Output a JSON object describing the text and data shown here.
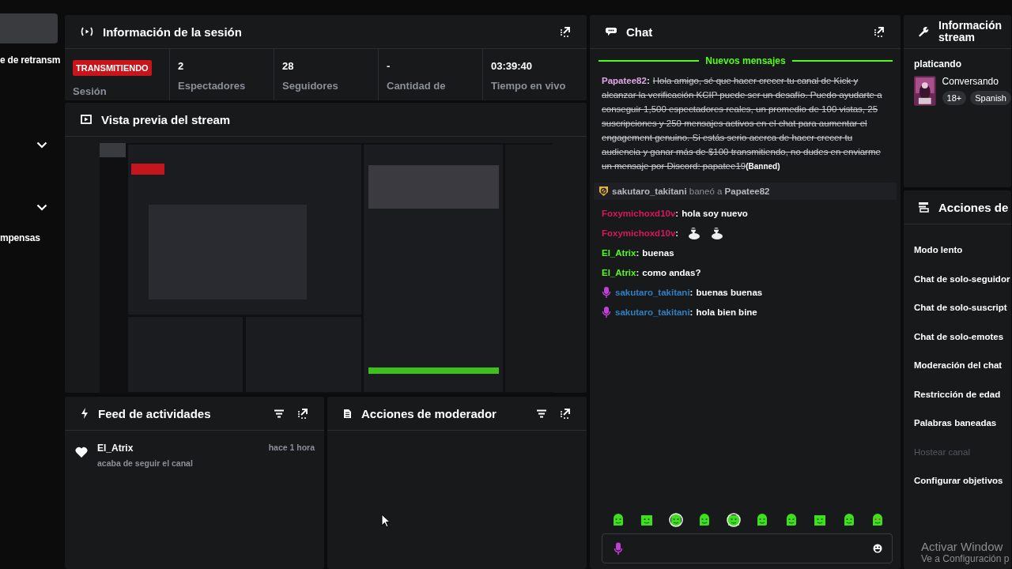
{
  "sidebar": {
    "items": [
      {
        "kind": "button"
      },
      {
        "kind": "text",
        "label": "e de retransm"
      },
      {
        "kind": "chevron"
      },
      {
        "kind": "chevron"
      },
      {
        "kind": "text",
        "label": "mpensas"
      }
    ]
  },
  "session": {
    "title": "Información de la sesión",
    "stats": [
      {
        "kind": "badge",
        "badge": "TRANSMITIENDO",
        "label": "Sesión"
      },
      {
        "kind": "value",
        "value": "2",
        "label": "Espectadores"
      },
      {
        "kind": "value",
        "value": "28",
        "label": "Seguidores"
      },
      {
        "kind": "value",
        "value": "-",
        "label": "Cantidad de"
      },
      {
        "kind": "value",
        "value": "03:39:40",
        "label": "Tiempo en vivo"
      }
    ]
  },
  "preview": {
    "title": "Vista previa del stream"
  },
  "feed": {
    "title": "Feed de actividades",
    "items": [
      {
        "user": "El_Atrix",
        "text": "acaba de seguir el canal",
        "time": "hace 1 hora"
      }
    ]
  },
  "moderator_actions": {
    "title": "Acciones de moderador"
  },
  "chat": {
    "title": "Chat",
    "divider": "Nuevos mensajes",
    "messages": [
      {
        "kind": "message",
        "user": "Papatee82",
        "color": "#dfa8e6",
        "separator": ":",
        "deleted": true,
        "mod_badge": false,
        "text": "Hola amigo, sé que hacer crecer tu canal de Kick y alcanzar la verificación KCIP puede ser un desafío. Puedo ayudarte a conseguir 1,500 espectadores reales, un promedio de 100 vistas, 25 suscripciones y 250 mensajes activos en el chat para aumentar el engagement genuino. Si estás serio acerca de hacer crecer tu audiencia y ganar más de $100 transmitiendo, no dudes en enviarme un mensaje por Discord: papatee19",
        "note": "(Banned)"
      },
      {
        "kind": "ban",
        "text": "**sakutaro_takitani** baneó a **Papatee82**"
      },
      {
        "kind": "message",
        "user": "Foxymichoxd10v",
        "color": "#d8185c",
        "separator": ":",
        "deleted": false,
        "mod_badge": false,
        "text": "hola soy nuevo"
      },
      {
        "kind": "emotes",
        "user": "Foxymichoxd10v",
        "color": "#d8185c",
        "separator": ":",
        "mod_badge": false
      },
      {
        "kind": "message",
        "user": "El_Atrix",
        "color": "#53fc18",
        "separator": ":",
        "deleted": false,
        "mod_badge": false,
        "text": "buenas"
      },
      {
        "kind": "message",
        "user": "El_Atrix",
        "color": "#53fc18",
        "separator": ":",
        "deleted": false,
        "mod_badge": false,
        "text": "como andas?"
      },
      {
        "kind": "message",
        "user": "sakutaro_takitani",
        "color": "#2e7fc4",
        "separator": ":",
        "deleted": false,
        "mod_badge": true,
        "text": "buenas buenas"
      },
      {
        "kind": "message",
        "user": "sakutaro_takitani",
        "color": "#2e7fc4",
        "separator": ":",
        "deleted": false,
        "mod_badge": true,
        "text": "hola bien bine"
      }
    ]
  },
  "stream_info": {
    "title_lines": [
      "Información",
      "stream"
    ],
    "category": "platicando",
    "activity": "Conversando",
    "tags": [
      "18+",
      "Spanish"
    ]
  },
  "channel_actions": {
    "title": "Acciones de",
    "items": [
      {
        "label": "Modo lento",
        "disabled": false
      },
      {
        "label": "Chat de solo-seguidor",
        "disabled": false
      },
      {
        "label": "Chat de solo-suscript",
        "disabled": false
      },
      {
        "label": "Chat de solo-emotes",
        "disabled": false
      },
      {
        "label": "Moderación del chat",
        "disabled": false
      },
      {
        "label": "Restricción de edad",
        "disabled": false
      },
      {
        "label": "Palabras baneadas",
        "disabled": false
      },
      {
        "label": "Hostear canal",
        "disabled": true
      },
      {
        "label": "Configurar objetivos",
        "disabled": false
      }
    ]
  },
  "os_notice": {
    "line1": "Activar Window",
    "line2": "Ve a Configuración p"
  }
}
